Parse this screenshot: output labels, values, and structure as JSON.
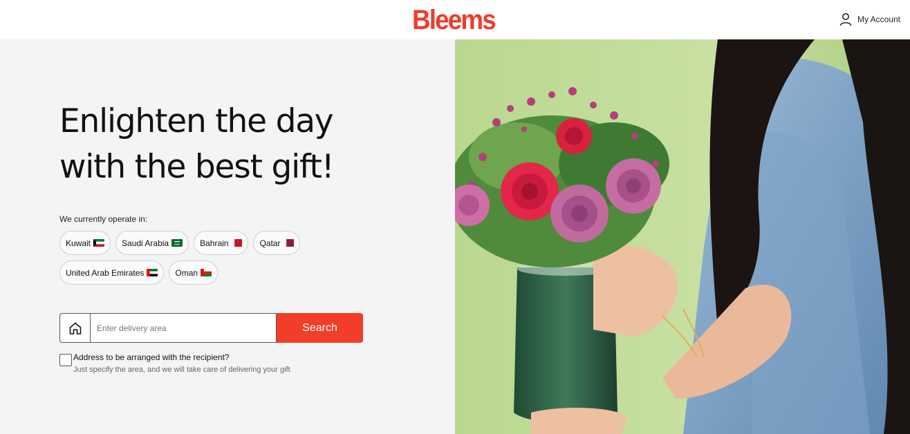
{
  "header": {
    "logo": "Bleems",
    "account_label": "My Account",
    "icons": {
      "account": "user-icon"
    }
  },
  "hero": {
    "headline_line1": "Enlighten the day",
    "headline_line2": "with the best gift!",
    "image_alt_icon": "flowers-photo"
  },
  "countries": {
    "label": "We currently operate in:",
    "items": [
      {
        "name": "Kuwait",
        "flag": "kuwait-flag-icon"
      },
      {
        "name": "Saudi Arabia",
        "flag": "saudi-flag-icon"
      },
      {
        "name": "Bahrain",
        "flag": "bahrain-flag-icon"
      },
      {
        "name": "Qatar",
        "flag": "qatar-flag-icon"
      },
      {
        "name": "United Arab Emirates",
        "flag": "uae-flag-icon"
      },
      {
        "name": "Oman",
        "flag": "oman-flag-icon"
      }
    ]
  },
  "search": {
    "placeholder": "Enter delivery area",
    "value": "",
    "button_label": "Search",
    "icon": "home-icon"
  },
  "recipient": {
    "checked": false,
    "title": "Address to be arranged with the recipient?",
    "subtitle": "Just specify the area, and we will take care of delivering your gift"
  },
  "colors": {
    "brand": "#f03c2c",
    "button": "#f23d29",
    "left_bg": "#f4f4f4"
  }
}
